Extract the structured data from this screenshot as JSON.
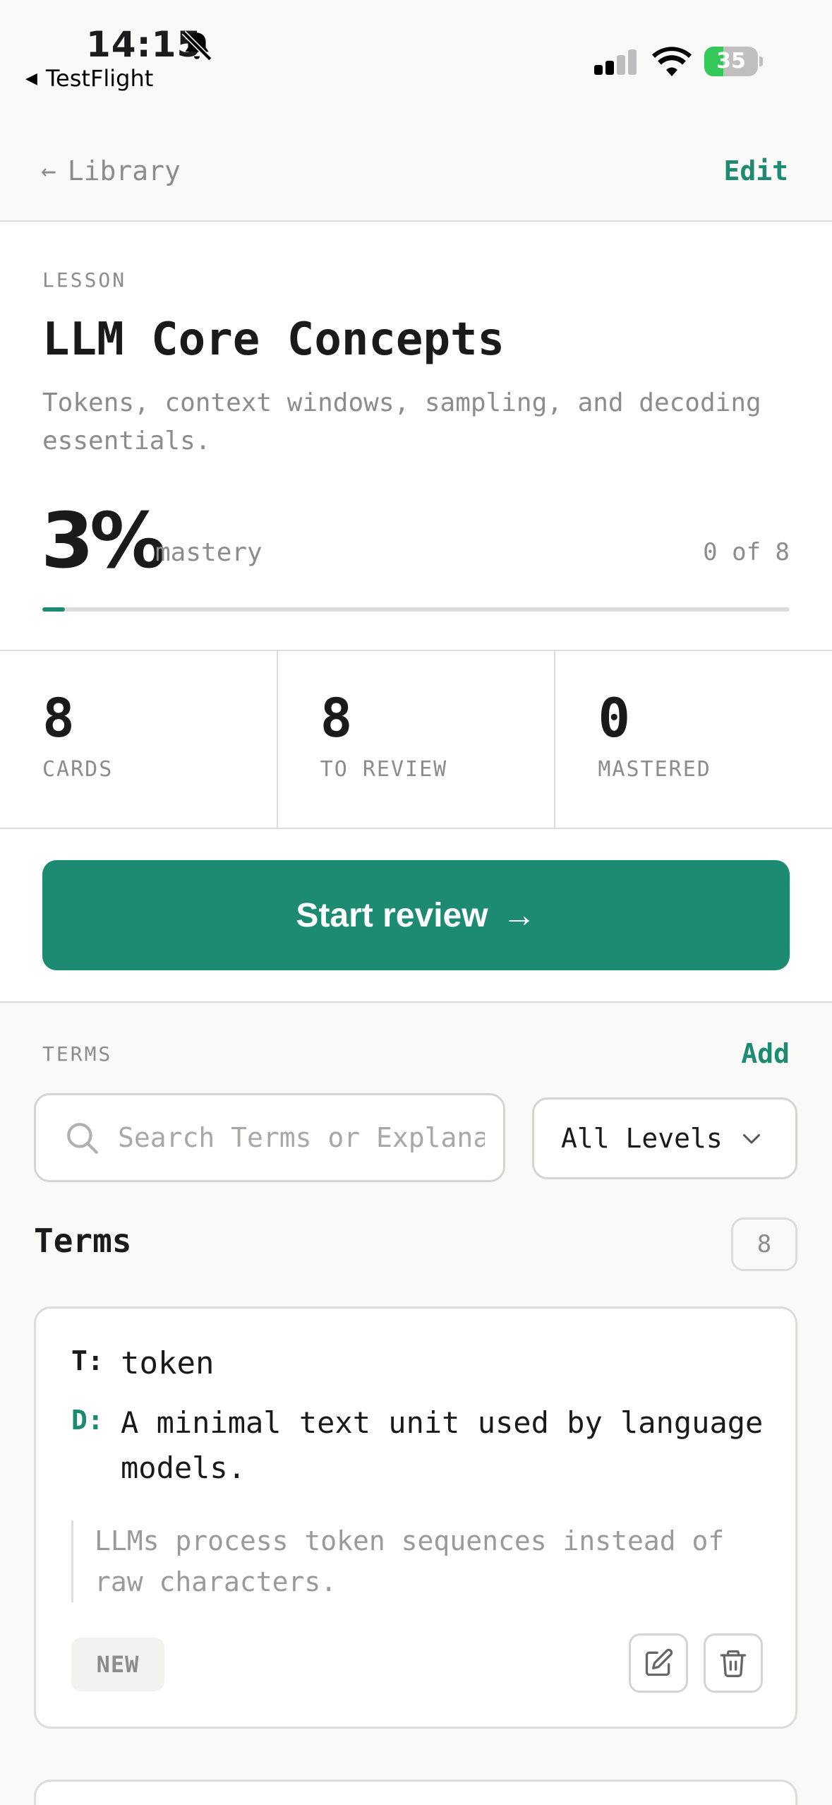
{
  "status_bar": {
    "time": "14:15",
    "back_app": "TestFlight",
    "battery": "35",
    "battery_level": 0.35
  },
  "nav": {
    "back_label": "Library",
    "edit_label": "Edit"
  },
  "lesson": {
    "eyebrow": "LESSON",
    "title": "LLM Core Concepts",
    "description": "Tokens, context windows, sampling, and decoding essentials.",
    "mastery_percent": "3%",
    "mastery_value": 0.03,
    "mastery_label": "mastery",
    "progress_count": "0 of 8"
  },
  "stats": [
    {
      "value": "8",
      "label": "CARDS"
    },
    {
      "value": "8",
      "label": "TO REVIEW"
    },
    {
      "value": "0",
      "label": "MASTERED"
    }
  ],
  "cta": {
    "label": "Start review",
    "arrow": "→"
  },
  "terms_section": {
    "heading": "TERMS",
    "add_label": "Add",
    "search_placeholder": "Search Terms or Explanations",
    "level_filter": "All Levels",
    "list_title": "Terms",
    "list_count": "8"
  },
  "terms": [
    {
      "term_key": "T:",
      "term": "token",
      "definition_key": "D:",
      "definition": "A minimal text unit used by language models.",
      "example": "LLMs process token sequences instead of raw characters.",
      "status": "NEW"
    }
  ],
  "colors": {
    "accent": "#1c8b72",
    "muted_text": "#8c8c8a",
    "border": "#dcdcdb",
    "background": "#f9f9f8",
    "battery_green": "#34c759"
  },
  "icons": {
    "bell": "bell-slash-icon",
    "search": "search-icon",
    "chevron": "chevron-down-icon",
    "edit": "edit-icon",
    "delete": "trash-icon"
  }
}
